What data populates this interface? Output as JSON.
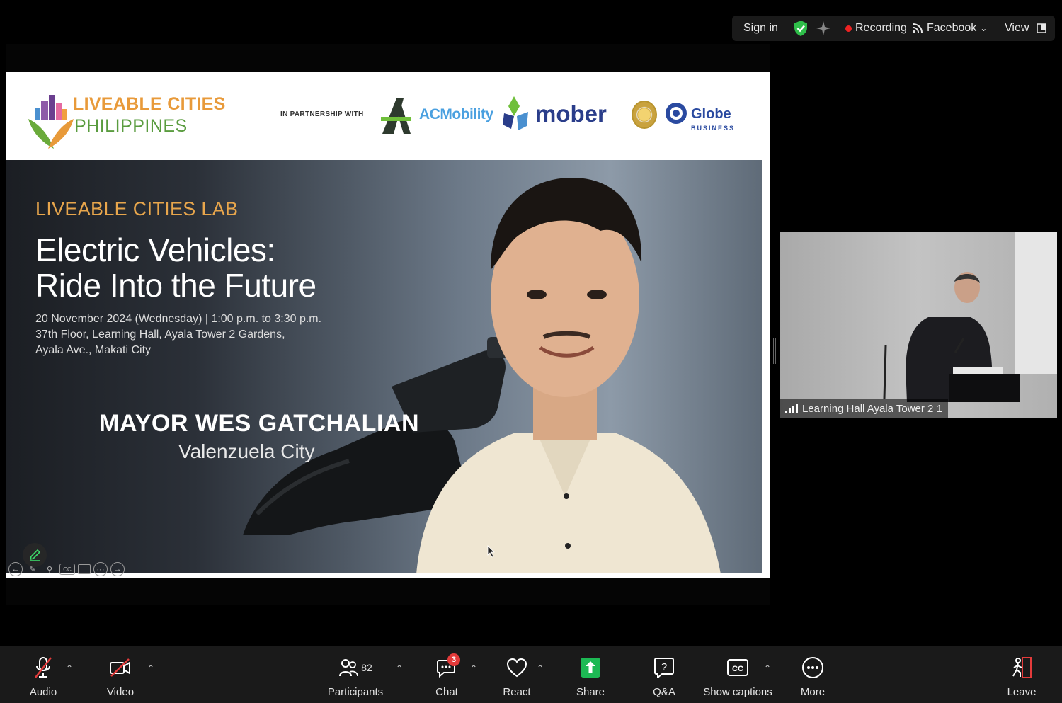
{
  "topbar": {
    "sign_in": "Sign in",
    "recording": "Recording",
    "facebook": "Facebook",
    "view": "View"
  },
  "slide": {
    "org_line1": "LIVEABLE CITIES",
    "org_line2": "PHILIPPINES",
    "partnership": "IN PARTNERSHIP WITH",
    "partner1": "ACMobility",
    "partner2": "mober",
    "partner3": "Globe",
    "partner3_sub": "BUSINESS",
    "lab_title": "LIVEABLE CITIES LAB",
    "title_line1": "Electric Vehicles:",
    "title_line2": "Ride Into the Future",
    "info_line1": "20 November 2024 (Wednesday) | 1:00 p.m. to 3:30 p.m.",
    "info_line2": "37th Floor, Learning Hall, Ayala Tower 2 Gardens,",
    "info_line3": "Ayala Ave., Makati City",
    "speaker_name": "MAYOR WES GATCHALIAN",
    "speaker_city": "Valenzuela City"
  },
  "participant_tile": {
    "name": "Learning Hall Ayala Tower 2 1"
  },
  "toolbar": {
    "audio": "Audio",
    "video": "Video",
    "participants": "Participants",
    "participant_count": "82",
    "chat": "Chat",
    "chat_badge": "3",
    "react": "React",
    "share": "Share",
    "qa": "Q&A",
    "captions": "Show captions",
    "more": "More",
    "leave": "Leave"
  },
  "colors": {
    "share_green": "#1db954",
    "leave_red": "#e43b3b",
    "recording_red": "#ee2222",
    "shield_green": "#2fbf4a"
  }
}
